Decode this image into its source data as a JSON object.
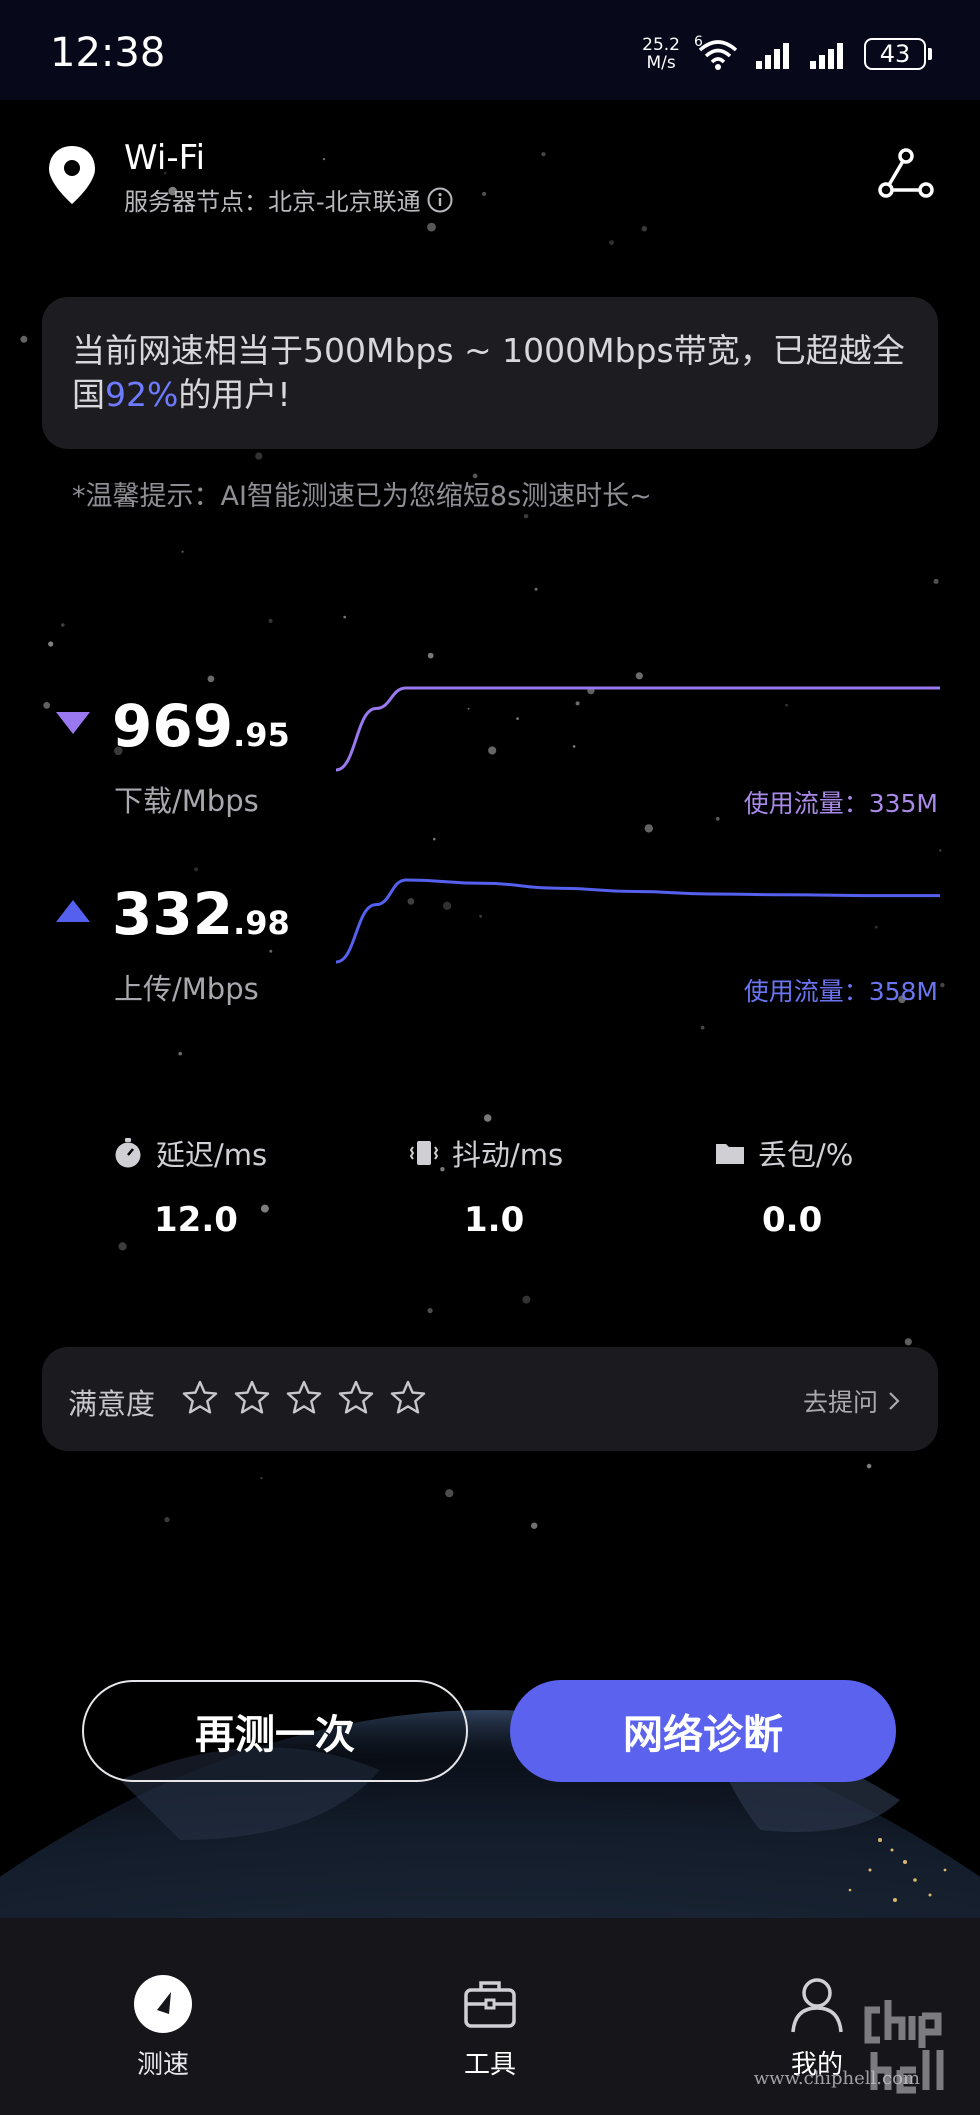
{
  "status_bar": {
    "time": "12:38",
    "net_speed_value": "25.2",
    "net_speed_unit": "M/s",
    "wifi_badge": "6",
    "battery": "43",
    "icons": [
      "wifi-icon",
      "signal-icon",
      "signal-icon",
      "battery-icon"
    ]
  },
  "header": {
    "network_name": "Wi-Fi",
    "server_label": "服务器节点：北京-北京联通",
    "icons": [
      "location-pin-icon",
      "info-icon",
      "share-icon"
    ]
  },
  "summary": {
    "prefix": "当前网速相当于500Mbps ~ 1000Mbps带宽，已超越全国",
    "percent": "92%",
    "suffix": "的用户!",
    "highlight_color": "#6f7bff"
  },
  "tip": "*温馨提示：AI智能测速已为您缩短8s测速时长~",
  "download": {
    "value_int": "969",
    "value_dec": ".95",
    "unit": "下载/Mbps",
    "traffic": "使用流量：335M",
    "color": "#9a78f0",
    "curve": [
      0.0,
      0.75,
      1.0,
      1.0,
      1.0,
      1.0,
      1.0,
      1.0,
      1.0,
      1.0
    ]
  },
  "upload": {
    "value_int": "332",
    "value_dec": ".98",
    "unit": "上传/Mbps",
    "traffic": "使用流量：358M",
    "color": "#5560ee",
    "curve": [
      0.0,
      0.7,
      1.0,
      0.96,
      0.9,
      0.86,
      0.83,
      0.82,
      0.81,
      0.81
    ]
  },
  "metrics": [
    {
      "label": "延迟/ms",
      "value": "12.0",
      "icon": "stopwatch-icon"
    },
    {
      "label": "抖动/ms",
      "value": "1.0",
      "icon": "jitter-icon"
    },
    {
      "label": "丢包/%",
      "value": "0.0",
      "icon": "folder-icon"
    }
  ],
  "rating": {
    "label": "满意度",
    "stars": 5,
    "filled": 0,
    "feedback": "去提问"
  },
  "buttons": {
    "retest": "再测一次",
    "diagnose": "网络诊断",
    "accent": "#5b62ee"
  },
  "nav": [
    {
      "label": "测速",
      "icon": "speedometer-icon"
    },
    {
      "label": "工具",
      "icon": "toolbox-icon"
    },
    {
      "label": "我的",
      "icon": "user-icon"
    }
  ],
  "watermark": {
    "text": "www.chiphell.com",
    "logo_text": "chiphell"
  }
}
